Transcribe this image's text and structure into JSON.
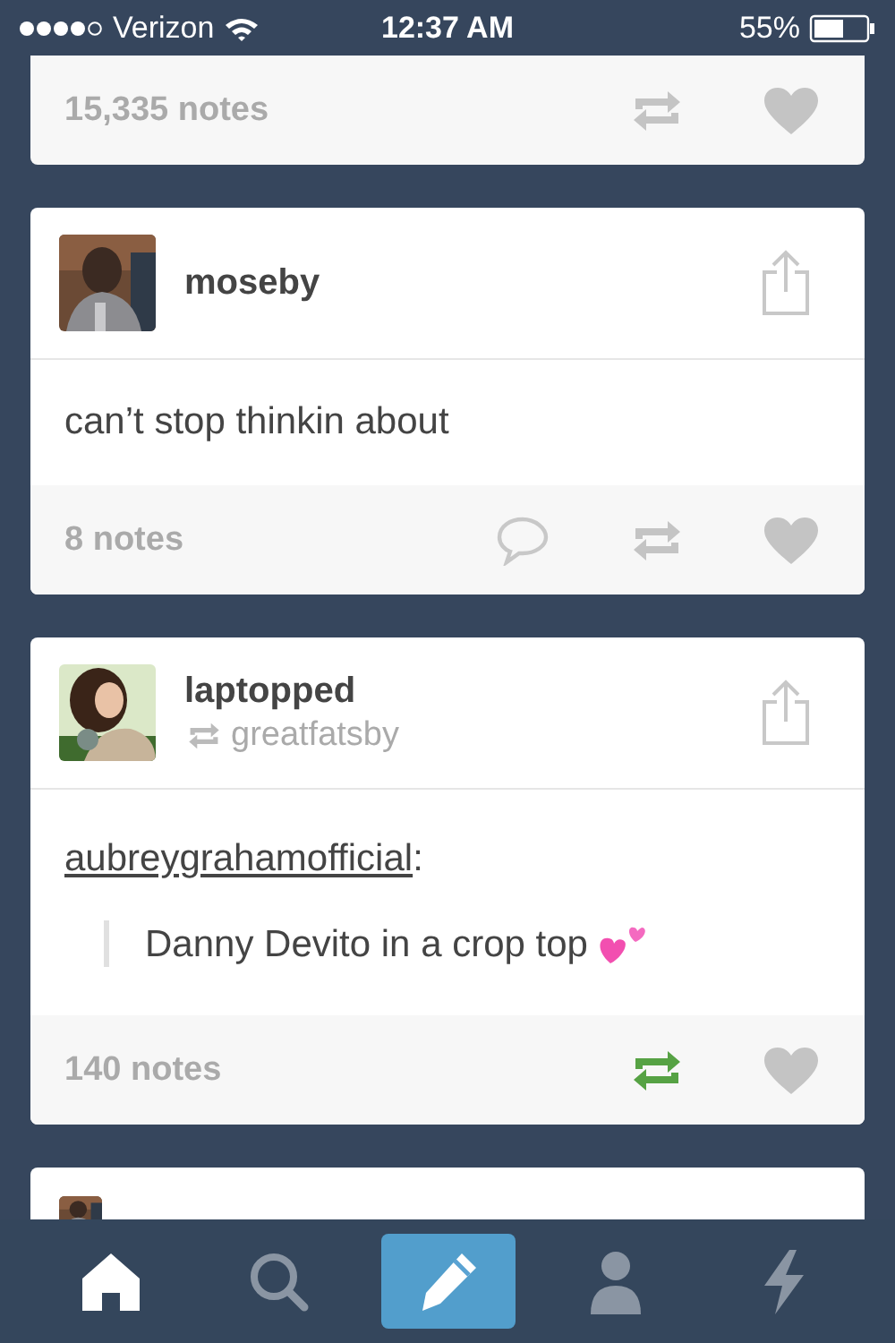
{
  "status_bar": {
    "carrier": "Verizon",
    "time": "12:37 AM",
    "battery": "55%"
  },
  "posts": [
    {
      "kind": "post",
      "notes": "15,335 notes",
      "can_reply": false,
      "reblogged": false,
      "liked": false
    },
    {
      "kind": "post",
      "header": {
        "name": "moseby"
      },
      "body": {
        "kind": "text",
        "text": "can’t stop thinkin about"
      },
      "notes": "8 notes",
      "can_reply": true,
      "reblogged": false,
      "liked": false
    },
    {
      "kind": "post",
      "header": {
        "name": "laptopped",
        "source": "greatfatsby"
      },
      "body": {
        "kind": "quote",
        "source": "aubreygrahamofficial",
        "colon": ":",
        "text": "Danny Devito in a crop top"
      },
      "notes": "140 notes",
      "can_reply": false,
      "reblogged": true,
      "liked": false
    },
    {
      "kind": "partial"
    }
  ],
  "tab_bar": [
    {
      "kind": "home",
      "selected": true
    },
    {
      "kind": "search",
      "selected": false
    },
    {
      "kind": "compose",
      "selected": false
    },
    {
      "kind": "account",
      "selected": false
    },
    {
      "kind": "activity",
      "selected": false
    }
  ]
}
